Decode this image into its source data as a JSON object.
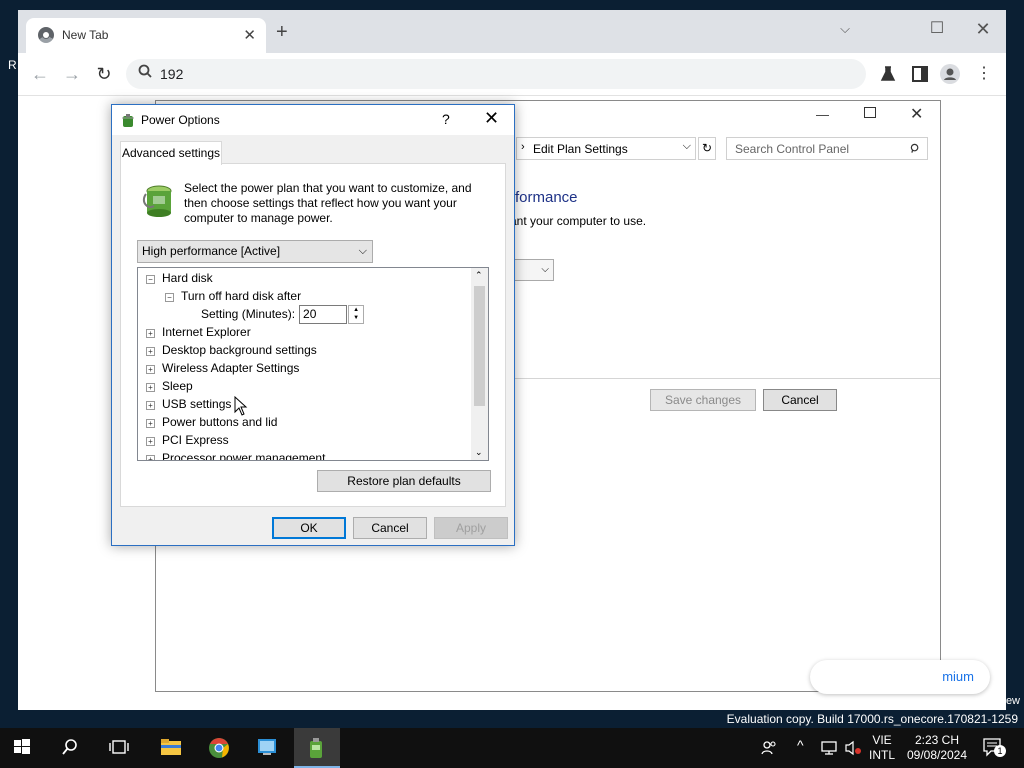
{
  "desktop": {
    "left_text": "R",
    "right_text": "ew",
    "watermark": "Evaluation copy. Build 17000.rs_onecore.170821-1259"
  },
  "browser": {
    "tab_title": "New Tab",
    "new_tab": "+",
    "address_text": "192",
    "menu_glyph": "⋮"
  },
  "control_panel": {
    "breadcrumb": "Edit Plan Settings",
    "search_placeholder": "Search Control Panel",
    "heading_fragment": "rformance",
    "subtext_fragment": "ant your computer to use.",
    "save_label": "Save changes",
    "cancel_label": "Cancel",
    "premium_fragment": "mium"
  },
  "dialog": {
    "title": "Power Options",
    "help": "?",
    "tab_label": "Advanced settings",
    "description": "Select the power plan that you want to customize, and then choose settings that reflect how you want your computer to manage power.",
    "plan_selected": "High performance [Active]",
    "tree": [
      {
        "label": "Hard disk",
        "toggle": "−"
      },
      {
        "label": "Turn off hard disk after",
        "toggle": "−"
      },
      {
        "label": "Setting (Minutes):",
        "value": "20"
      },
      {
        "label": "Internet Explorer",
        "toggle": "+"
      },
      {
        "label": "Desktop background settings",
        "toggle": "+"
      },
      {
        "label": "Wireless Adapter Settings",
        "toggle": "+"
      },
      {
        "label": "Sleep",
        "toggle": "+"
      },
      {
        "label": "USB settings",
        "toggle": "+"
      },
      {
        "label": "Power buttons and lid",
        "toggle": "+"
      },
      {
        "label": "PCI Express",
        "toggle": "+"
      },
      {
        "label": "Processor power management",
        "toggle": "+"
      }
    ],
    "restore_label": "Restore plan defaults",
    "ok_label": "OK",
    "cancel_label": "Cancel",
    "apply_label": "Apply"
  },
  "taskbar": {
    "lang_line1": "VIE",
    "lang_line2": "INTL",
    "time": "2:23 CH",
    "date": "09/08/2024",
    "notification_count": "1",
    "apps": [
      "start-icon",
      "search-icon",
      "task-view-icon",
      "file-explorer-icon",
      "chrome-icon",
      "control-panel-icon",
      "power-options-icon"
    ]
  },
  "colors": {
    "accent": "#0078d7",
    "heading_blue": "#1e3287",
    "chrome_frame": "#dee1e6",
    "taskbar": "#101010"
  }
}
